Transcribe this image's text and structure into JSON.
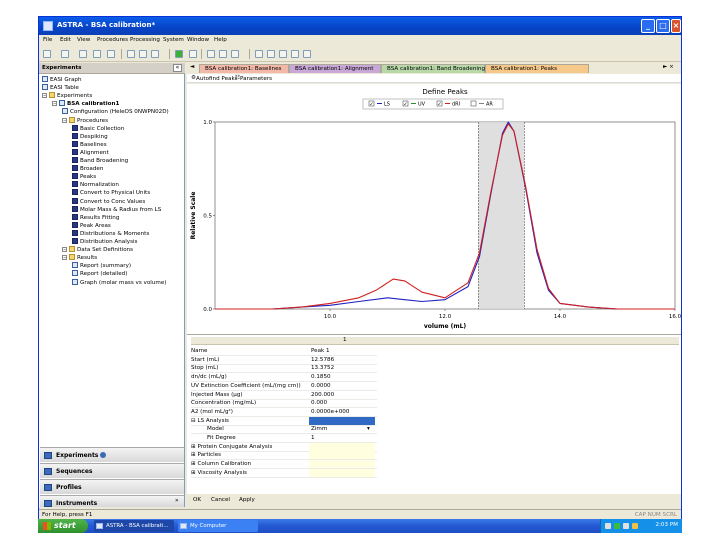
{
  "window": {
    "title": "ASTRA - BSA calibration*",
    "buttons": {
      "minimize": "_",
      "maximize": "□",
      "close": "×"
    }
  },
  "menu": [
    "File",
    "Edit",
    "View",
    "Procedures",
    "Processing",
    "System",
    "Window",
    "Help"
  ],
  "left_panel": {
    "header": "Experiments",
    "collapse": "«",
    "tree": [
      {
        "label": "EASI Graph",
        "level": 0,
        "icon": "graph-icon"
      },
      {
        "label": "EASI Table",
        "level": 0,
        "icon": "table-icon"
      },
      {
        "label": "Experiments",
        "level": 0,
        "icon": "folder-icon"
      },
      {
        "label": "BSA calibration1",
        "level": 1,
        "icon": "experiment-icon",
        "bold": true
      },
      {
        "label": "Configuration (HeleOS 0NWPN02D)",
        "level": 2,
        "icon": "config-icon"
      },
      {
        "label": "Procedures",
        "level": 2,
        "icon": "folder-icon"
      },
      {
        "label": "Basic Collection",
        "level": 3,
        "icon": "procedure-icon"
      },
      {
        "label": "Despiking",
        "level": 3,
        "icon": "procedure-icon"
      },
      {
        "label": "Baselines",
        "level": 3,
        "icon": "procedure-icon"
      },
      {
        "label": "Alignment",
        "level": 3,
        "icon": "procedure-icon"
      },
      {
        "label": "Band Broadening",
        "level": 3,
        "icon": "procedure-icon"
      },
      {
        "label": "Broaden",
        "level": 3,
        "icon": "procedure-icon"
      },
      {
        "label": "Peaks",
        "level": 3,
        "icon": "procedure-icon"
      },
      {
        "label": "Normalization",
        "level": 3,
        "icon": "procedure-icon"
      },
      {
        "label": "Convert to Physical Units",
        "level": 3,
        "icon": "procedure-icon"
      },
      {
        "label": "Convert to Conc Values",
        "level": 3,
        "icon": "procedure-icon"
      },
      {
        "label": "Molar Mass & Radius from LS",
        "level": 3,
        "icon": "procedure-icon"
      },
      {
        "label": "Results Fitting",
        "level": 3,
        "icon": "procedure-icon"
      },
      {
        "label": "Peak Areas",
        "level": 3,
        "icon": "procedure-icon"
      },
      {
        "label": "Distributions & Moments",
        "level": 3,
        "icon": "procedure-icon"
      },
      {
        "label": "Distribution Analysis",
        "level": 3,
        "icon": "procedure-icon"
      },
      {
        "label": "Data Set Definitions",
        "level": 2,
        "icon": "folder-icon"
      },
      {
        "label": "Results",
        "level": 2,
        "icon": "folder-icon"
      },
      {
        "label": "Report (summary)",
        "level": 3,
        "icon": "report-icon"
      },
      {
        "label": "Report (detailed)",
        "level": 3,
        "icon": "report-icon"
      },
      {
        "label": "Graph (molar mass vs volume)",
        "level": 3,
        "icon": "graph-icon"
      }
    ],
    "nav": [
      "Experiments",
      "Sequences",
      "Profiles",
      "Instruments"
    ],
    "footer_arrow": "»"
  },
  "tabs": [
    {
      "label": "BSA calibration1: Baselines",
      "color": "#f2b8a8"
    },
    {
      "label": "BSA calibration1: Alignment",
      "color": "#c9a8d8"
    },
    {
      "label": "BSA calibration1: Band Broadening",
      "color": "#b8d8a8"
    },
    {
      "label": "BSA calibration1: Peaks",
      "color": "#f6c98a"
    }
  ],
  "tab_nav": {
    "left": "◄",
    "right": "► ×"
  },
  "subtabs": [
    "Autofind Peaks",
    "Parameters"
  ],
  "chart_data": {
    "type": "line",
    "title": "Define Peaks",
    "xlabel": "volume (mL)",
    "ylabel": "Relative Scale",
    "xlim": [
      8.0,
      16.0
    ],
    "ylim": [
      0.0,
      1.0
    ],
    "xticks": [
      "10.0",
      "12.0",
      "14.0",
      "16.0"
    ],
    "yticks": [
      "0.0",
      "0.5",
      "1.0"
    ],
    "legend": [
      {
        "label": "LS",
        "checked": true,
        "color": "#1f1fbf"
      },
      {
        "label": "UV",
        "checked": true,
        "color": "#2e8b2e"
      },
      {
        "label": "dRI",
        "checked": true,
        "color": "#d62020"
      },
      {
        "label": "AR",
        "checked": false,
        "color": "#808080"
      }
    ],
    "selected_region": [
      12.58,
      13.38
    ],
    "series": [
      {
        "name": "LS",
        "color": "#2020c0",
        "x": [
          8.0,
          9.0,
          9.5,
          10.0,
          10.5,
          11.0,
          11.3,
          11.6,
          12.0,
          12.4,
          12.6,
          12.8,
          13.0,
          13.1,
          13.2,
          13.4,
          13.6,
          13.8,
          14.0,
          14.5,
          15.0,
          16.0
        ],
        "y": [
          0.0,
          0.0,
          0.01,
          0.02,
          0.04,
          0.06,
          0.05,
          0.04,
          0.05,
          0.12,
          0.28,
          0.62,
          0.94,
          1.0,
          0.95,
          0.65,
          0.3,
          0.1,
          0.03,
          0.01,
          0.0,
          0.0
        ]
      },
      {
        "name": "dRI",
        "color": "#d02020",
        "x": [
          8.0,
          9.0,
          9.5,
          10.0,
          10.5,
          10.8,
          11.1,
          11.3,
          11.6,
          12.0,
          12.4,
          12.6,
          12.8,
          13.0,
          13.1,
          13.2,
          13.4,
          13.6,
          13.8,
          14.0,
          14.5,
          15.0,
          16.0
        ],
        "y": [
          0.0,
          0.0,
          0.01,
          0.03,
          0.06,
          0.1,
          0.16,
          0.15,
          0.09,
          0.06,
          0.14,
          0.3,
          0.63,
          0.93,
          0.99,
          0.95,
          0.66,
          0.32,
          0.11,
          0.03,
          0.01,
          0.0,
          0.0
        ]
      }
    ]
  },
  "grid": {
    "column_header": "1",
    "rows": [
      {
        "label": "Name",
        "value": "Peak 1"
      },
      {
        "label": "Start (mL)",
        "value": "12.5786"
      },
      {
        "label": "Stop (mL)",
        "value": "13.3752"
      },
      {
        "label": "dn/dc (mL/g)",
        "value": "0.1850"
      },
      {
        "label": "UV Extinction Coefficient (mL/(mg cm))",
        "value": "0.0000"
      },
      {
        "label": "Injected Mass (µg)",
        "value": "200.000"
      },
      {
        "label": "Concentration (mg/mL)",
        "value": "0.000"
      },
      {
        "label": "A2 (mol mL/g²)",
        "value": "0.0000e+000"
      },
      {
        "label": "⊟ LS Analysis",
        "value": "",
        "selected": true
      },
      {
        "label": "Model",
        "value": "Zimm",
        "indent": true,
        "dropdown": true
      },
      {
        "label": "Fit Degree",
        "value": "1",
        "indent": true
      },
      {
        "label": "⊞ Protein Conjugate Analysis",
        "value": ""
      },
      {
        "label": "⊞ Particles",
        "value": ""
      },
      {
        "label": "⊞ Column Calibration",
        "value": ""
      },
      {
        "label": "⊞ Viscosity Analysis",
        "value": ""
      }
    ]
  },
  "buttons": [
    "OK",
    "Cancel",
    "Apply"
  ],
  "status": {
    "left": "For Help, press F1",
    "right": "CAP  NUM  SCRL"
  },
  "taskbar": {
    "start": "start",
    "tasks": [
      "ASTRA - BSA calibrati...",
      "My Computer"
    ],
    "clock": "2:03 PM"
  }
}
